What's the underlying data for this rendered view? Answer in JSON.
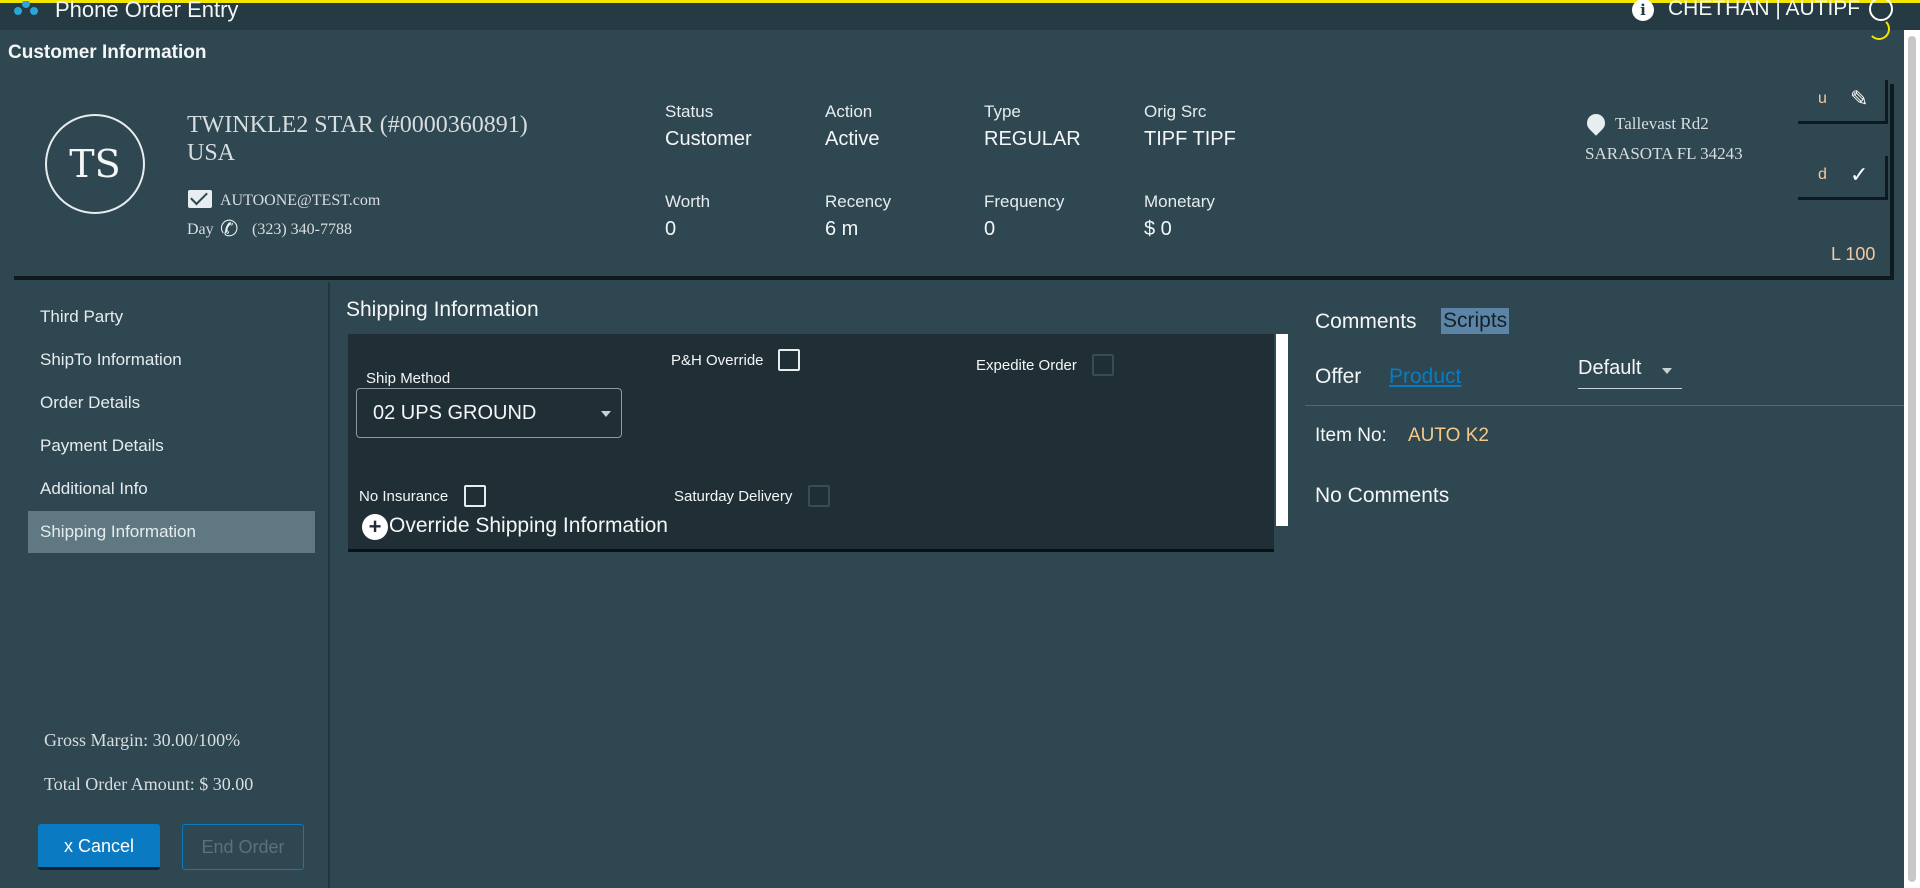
{
  "header": {
    "app_title": "Phone Order Entry",
    "user": "CHETHAN | AUTIPF",
    "accent_color": "#f2e600"
  },
  "page": {
    "section_title": "Customer Information"
  },
  "customer": {
    "initials": "TS",
    "name": "TWINKLE2 STAR (#0000360891)",
    "country": "USA",
    "email": "AUTOONE@TEST.com",
    "phone_label": "Day",
    "phone": "(323) 340-7788",
    "address_line1": "Tallevast Rd2",
    "address_line2": "SARASOTA FL 34243",
    "stats": {
      "status": {
        "label": "Status",
        "value": "Customer"
      },
      "action": {
        "label": "Action",
        "value": "Active"
      },
      "type": {
        "label": "Type",
        "value": "REGULAR"
      },
      "orig_src": {
        "label": "Orig Src",
        "value": "TIPF TIPF"
      },
      "worth": {
        "label": "Worth",
        "value": "0"
      },
      "recency": {
        "label": "Recency",
        "value": "6 m"
      },
      "frequency": {
        "label": "Frequency",
        "value": "0"
      },
      "monetary": {
        "label": "Monetary",
        "value": "$ 0"
      }
    },
    "side_buttons": {
      "edit_key": "u",
      "verify_key": "d",
      "level": "L 100"
    }
  },
  "nav": {
    "items": [
      {
        "label": "Third Party"
      },
      {
        "label": "ShipTo Information"
      },
      {
        "label": "Order Details"
      },
      {
        "label": "Payment Details"
      },
      {
        "label": "Additional Info"
      },
      {
        "label": "Shipping Information"
      }
    ],
    "gross_margin": "Gross Margin: 30.00/100%",
    "total_order": "Total Order Amount: $ 30.00",
    "cancel_label": "x  Cancel",
    "end_label": "End Order"
  },
  "shipping": {
    "title": "Shipping Information",
    "ship_method_label": "Ship Method",
    "ship_method_value": "02 UPS GROUND",
    "ph_override_label": "P&H Override",
    "expedite_label": "Expedite Order",
    "no_insurance_label": "No Insurance",
    "saturday_label": "Saturday Delivery",
    "override_label": "Override Shipping Information"
  },
  "comments": {
    "tab_comments": "Comments",
    "tab_scripts": "Scripts",
    "offer_label": "Offer",
    "product_link": "Product",
    "default_select": "Default",
    "item_no_label": "Item No:",
    "item_no_value": "AUTO K2",
    "no_comments": "No Comments"
  }
}
